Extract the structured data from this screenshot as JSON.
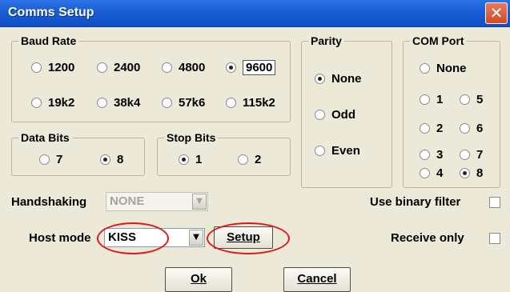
{
  "window": {
    "title": "Comms Setup",
    "close_glyph": "✕"
  },
  "baud_rate": {
    "legend": "Baud Rate",
    "options": [
      "1200",
      "2400",
      "4800",
      "9600",
      "19k2",
      "38k4",
      "57k6",
      "115k2"
    ],
    "selected": "9600"
  },
  "parity": {
    "legend": "Parity",
    "options": [
      "None",
      "Odd",
      "Even"
    ],
    "selected": "None"
  },
  "com_port": {
    "legend": "COM Port",
    "options": [
      "None",
      "1",
      "5",
      "2",
      "6",
      "3",
      "7",
      "4",
      "8"
    ],
    "selected": "8"
  },
  "data_bits": {
    "legend": "Data Bits",
    "options": [
      "7",
      "8"
    ],
    "selected": "8"
  },
  "stop_bits": {
    "legend": "Stop Bits",
    "options": [
      "1",
      "2"
    ],
    "selected": "1"
  },
  "handshaking": {
    "label": "Handshaking",
    "value": "NONE",
    "disabled": true
  },
  "host_mode": {
    "label": "Host mode",
    "value": "KISS"
  },
  "setup_button": {
    "label": "Setup"
  },
  "use_binary_filter": {
    "label": "Use binary filter",
    "checked": false
  },
  "receive_only": {
    "label": "Receive only",
    "checked": false
  },
  "ok_button": {
    "label": "Ok"
  },
  "cancel_button": {
    "label": "Cancel"
  },
  "colors": {
    "title_bar": "#0e4fc4",
    "annotation": "#e01818",
    "dialog_bg": "#ece9d8"
  }
}
